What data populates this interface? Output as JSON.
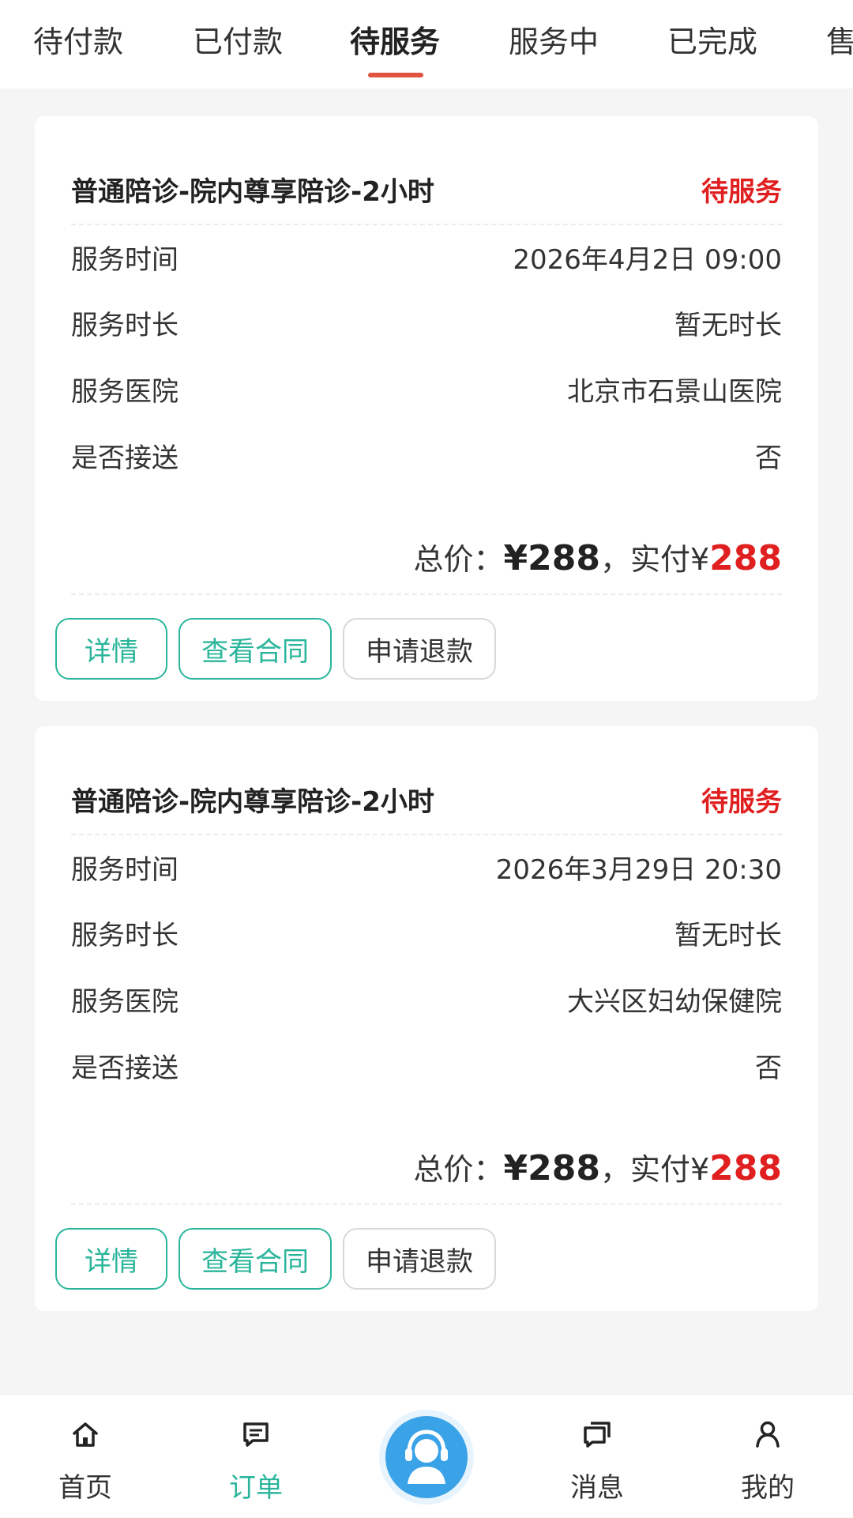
{
  "tabs": [
    {
      "label": "待付款"
    },
    {
      "label": "已付款"
    },
    {
      "label": "待服务"
    },
    {
      "label": "服务中"
    },
    {
      "label": "已完成"
    },
    {
      "label": "售"
    }
  ],
  "active_tab": "待服务",
  "orders": [
    {
      "title": "普通陪诊-院内尊享陪诊-2小时",
      "status": "待服务",
      "rows": [
        {
          "label": "服务时间",
          "value": "2026年4月2日 09:00"
        },
        {
          "label": "服务时长",
          "value": "暂无时长"
        },
        {
          "label": "服务医院",
          "value": "北京市石景山医院"
        },
        {
          "label": "是否接送",
          "value": "否"
        }
      ],
      "price_prefix": "总价：",
      "total": "¥288",
      "separator": "，",
      "paid_prefix": "实付¥",
      "paid": "288",
      "buttons": {
        "detail": "详情",
        "contract": "查看合同",
        "refund": "申请退款"
      }
    },
    {
      "title": "普通陪诊-院内尊享陪诊-2小时",
      "status": "待服务",
      "rows": [
        {
          "label": "服务时间",
          "value": "2026年3月29日 20:30"
        },
        {
          "label": "服务时长",
          "value": "暂无时长"
        },
        {
          "label": "服务医院",
          "value": "大兴区妇幼保健院"
        },
        {
          "label": "是否接送",
          "value": "否"
        }
      ],
      "price_prefix": "总价：",
      "total": "¥288",
      "separator": "，",
      "paid_prefix": "实付¥",
      "paid": "288",
      "buttons": {
        "detail": "详情",
        "contract": "查看合同",
        "refund": "申请退款"
      }
    }
  ],
  "bottom_nav": [
    {
      "label": "首页",
      "icon": "home-icon"
    },
    {
      "label": "订单",
      "icon": "order-icon",
      "active": true
    },
    {
      "label": "",
      "icon": "customer-service-icon"
    },
    {
      "label": "消息",
      "icon": "message-icon"
    },
    {
      "label": "我的",
      "icon": "profile-icon"
    }
  ],
  "colors": {
    "accent_green": "#2ab59b",
    "status_red": "#e02020",
    "tab_underline": "#e0533f",
    "center_button": "#3aa3e8"
  }
}
